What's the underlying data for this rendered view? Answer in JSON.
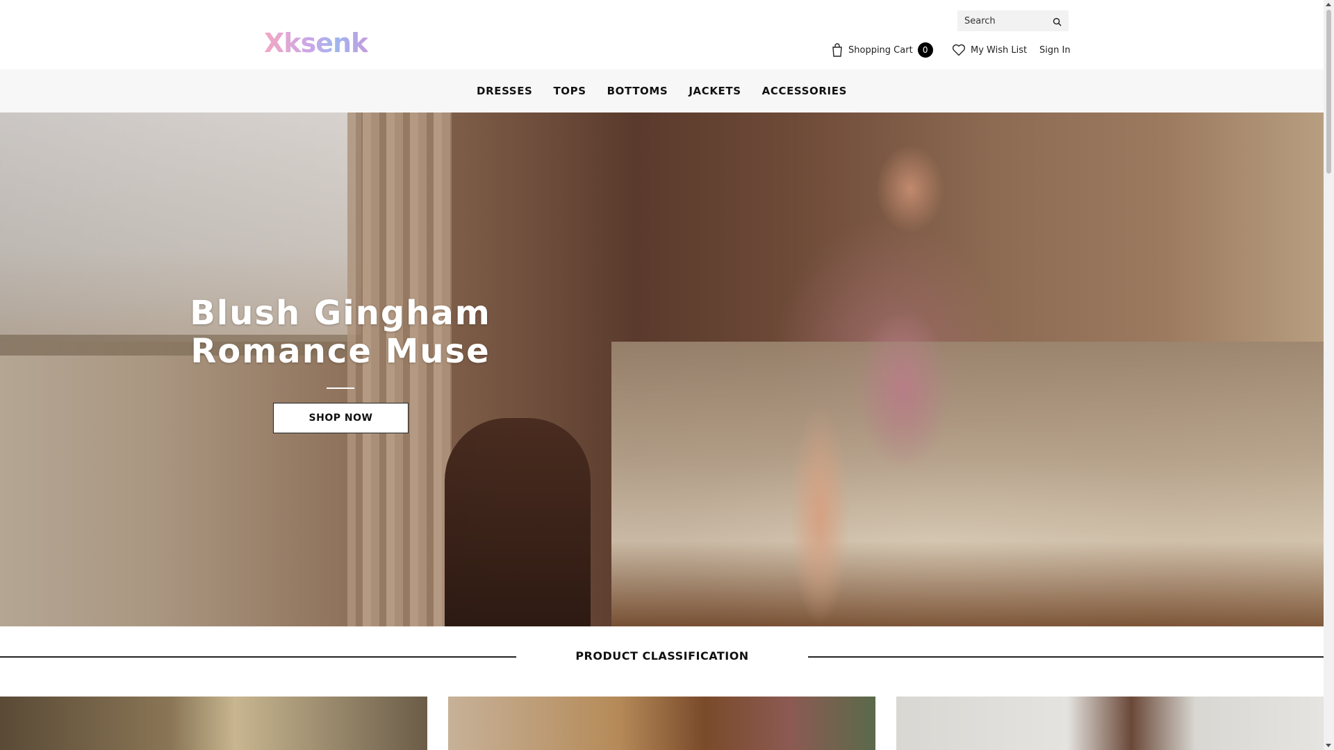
{
  "header": {
    "logo": "Xksenk",
    "search_placeholder": "Search",
    "cart_label": "Shopping Cart",
    "cart_count": "0",
    "wishlist_label": "My Wish List",
    "signin_label": "Sign In"
  },
  "nav": {
    "items": [
      "DRESSES",
      "TOPS",
      "BOTTOMS",
      "JACKETS",
      "ACCESSORIES"
    ]
  },
  "hero": {
    "title": "Blush Gingham Romance Muse",
    "cta": "SHOP NOW"
  },
  "section": {
    "title": "PRODUCT CLASSIFICATION"
  },
  "icons": {
    "search": "search-icon",
    "cart": "shopping-bag-icon",
    "wishlist": "heart-icon"
  }
}
